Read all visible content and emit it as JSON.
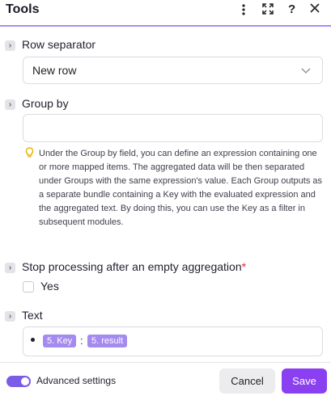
{
  "header": {
    "title": "Tools",
    "icons": [
      "more-vertical-icon",
      "expand-icon",
      "help-icon",
      "close-icon"
    ]
  },
  "fields": {
    "row_separator": {
      "label": "Row separator",
      "value": "New row"
    },
    "group_by": {
      "label": "Group by",
      "value": "",
      "hint": "Under the Group by field, you can define an expression containing one or more mapped items. The aggregated data will be then separated under Groups with the same expression's value. Each Group outputs as a separate bundle containing a Key with the evaluated expression and the aggregated text. By doing this, you can use the Key as a filter in subsequent modules."
    },
    "stop_processing": {
      "label": "Stop processing after an empty aggregation",
      "required_mark": "*",
      "checkbox_label": "Yes",
      "checked": false
    },
    "text": {
      "label": "Text",
      "tokens": [
        "5. Key",
        "5. result"
      ],
      "separator": ":"
    }
  },
  "footer": {
    "advanced_settings_label": "Advanced settings",
    "advanced_settings_on": true,
    "cancel_label": "Cancel",
    "save_label": "Save"
  },
  "colors": {
    "accent": "#8a3ff0",
    "token": "#a58af0",
    "toggle": "#7b5ce6",
    "hint_icon": "#e6b400",
    "required": "#e0263b"
  }
}
